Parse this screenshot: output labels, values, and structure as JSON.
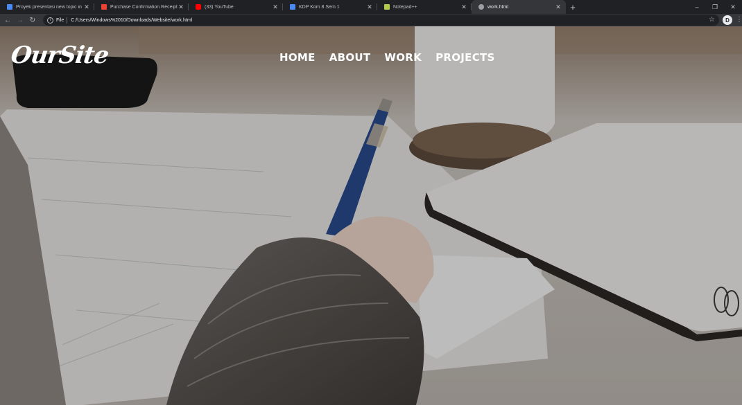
{
  "browser": {
    "tabs": [
      {
        "title": "Proyek presentasi new topic in Pu",
        "favicon_color": "#4a8af4",
        "active": false
      },
      {
        "title": "Purchase Confirmation Receipt -",
        "favicon_color": "#ea4335",
        "active": false
      },
      {
        "title": "(33) YouTube",
        "favicon_color": "#ff0000",
        "active": false
      },
      {
        "title": "KDP Kom 8 Sem 1",
        "favicon_color": "#4a8af4",
        "active": false
      },
      {
        "title": "Notepad++",
        "favicon_color": "#b5c94b",
        "active": false
      },
      {
        "title": "work.html",
        "favicon_color": "#9aa0a6",
        "active": true
      }
    ],
    "close_glyph": "✕",
    "new_tab_glyph": "+",
    "window_controls": {
      "minimize": "–",
      "restore": "❐",
      "close": "✕"
    },
    "toolbar": {
      "back": "←",
      "forward": "→",
      "reload": "↻"
    },
    "address": {
      "info_glyph": "i",
      "scheme_label": "File",
      "url": "C:/Users/Windows%2010/Downloads/Website/work.html",
      "star_glyph": "☆"
    },
    "extension_label": "D",
    "menu_glyph": "⋮"
  },
  "site": {
    "logo": "OurSite",
    "nav": [
      "HOME",
      "ABOUT",
      "WORK",
      "PROJECTS"
    ],
    "colors": {
      "nav_text": "#ffffff",
      "pen": "#2a4a8c"
    }
  }
}
